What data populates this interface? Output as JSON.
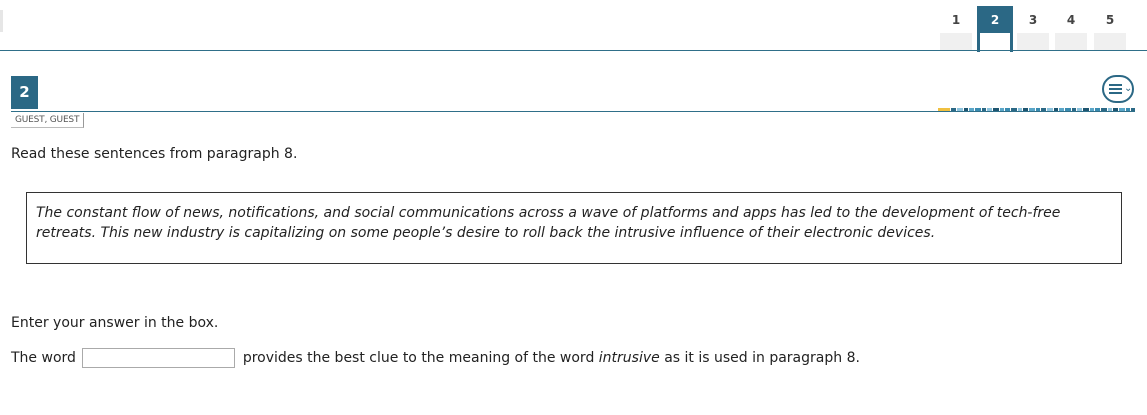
{
  "nav": {
    "questions": [
      {
        "label": "1"
      },
      {
        "label": "2"
      },
      {
        "label": "3"
      },
      {
        "label": "4"
      },
      {
        "label": "5"
      }
    ],
    "current_label": "2"
  },
  "question": {
    "number": "2",
    "user_name": "GUEST, GUEST",
    "menu_icon": "menu-lines-chevron-icon"
  },
  "content": {
    "prompt": "Read these sentences from paragraph 8.",
    "passage": "The constant flow of news, notifications, and social communications across a wave of platforms and apps has led to the development of tech-free retreats. This new industry is capitalizing on some people’s desire to roll back the intrusive influence of their electronic devices.",
    "instruction": "Enter your answer in the box.",
    "answer_prefix": "The word",
    "answer_value": "",
    "answer_suffix_1": "provides the best clue to the meaning of the word",
    "answer_keyword": "intrusive",
    "answer_suffix_2": "as it is used in paragraph 8."
  },
  "colors": {
    "accent": "#2b6885",
    "progress_current": "#f0c040"
  }
}
